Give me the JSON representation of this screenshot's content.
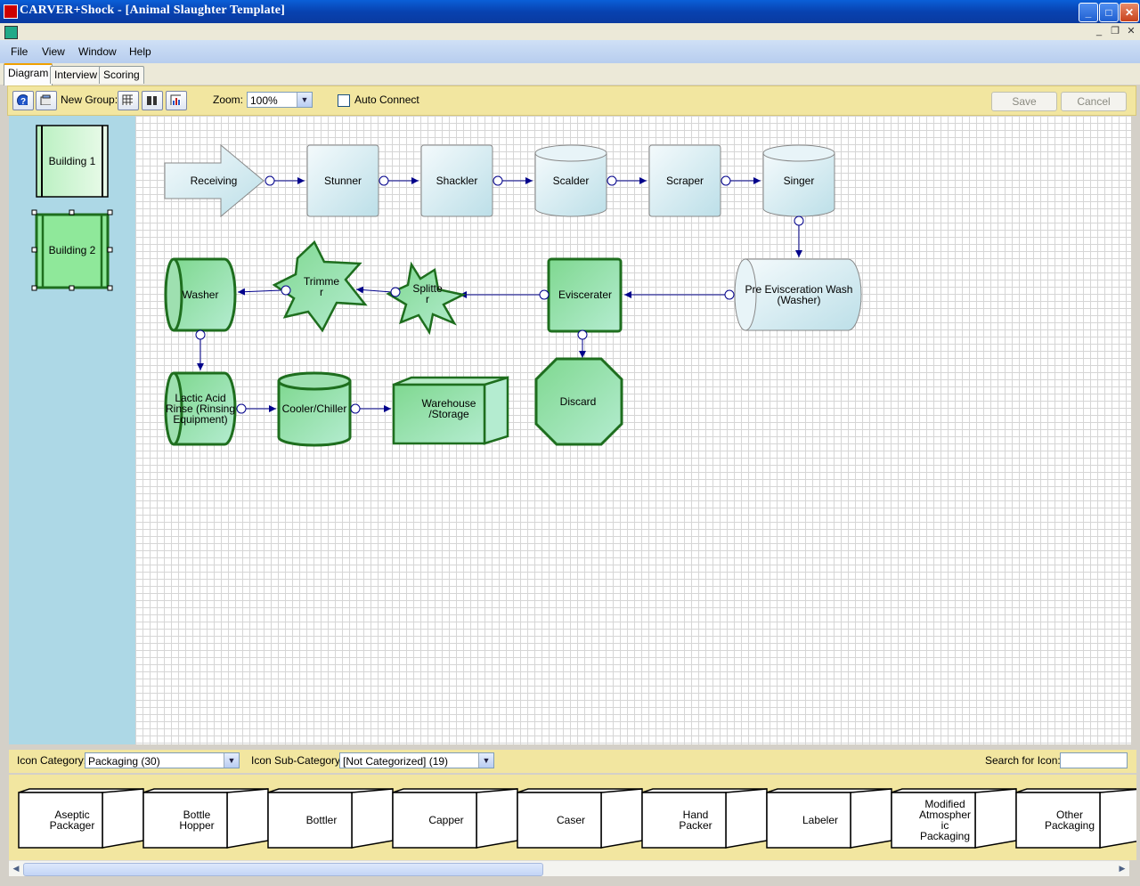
{
  "window": {
    "title": "CARVER+Shock - [Animal Slaughter Template]",
    "min_glyph": "_",
    "max_glyph": "□",
    "close_glyph": "✕",
    "mdi_min_glyph": "_",
    "mdi_restore_glyph": "❐",
    "mdi_close_glyph": "✕"
  },
  "menu": {
    "items": [
      "File",
      "View",
      "Window",
      "Help"
    ]
  },
  "tabs": [
    {
      "label": "Diagram",
      "active": true
    },
    {
      "label": "Interview",
      "active": false
    },
    {
      "label": "Scoring",
      "active": false
    }
  ],
  "toolbar": {
    "new_group_label": "New Group:",
    "zoom_label": "Zoom:",
    "zoom_value": "100%",
    "auto_connect_label": "Auto Connect",
    "auto_connect_checked": false,
    "save_label": "Save",
    "cancel_label": "Cancel"
  },
  "groups": [
    {
      "label": "Building 1",
      "selected": false
    },
    {
      "label": "Building 2",
      "selected": true
    }
  ],
  "diagram": {
    "nodes": {
      "receiving": [
        "Receiving"
      ],
      "stunner": [
        "Stunner"
      ],
      "shackler": [
        "Shackler"
      ],
      "scalder": [
        "Scalder"
      ],
      "scraper": [
        "Scraper"
      ],
      "singer": [
        "Singer"
      ],
      "pre_evisceration_wash": [
        "Pre Evisceration Wash",
        "(Washer)"
      ],
      "eviscerater": [
        "Eviscerater"
      ],
      "splitter": [
        "Splitte",
        "r"
      ],
      "trimmer": [
        "Trimme",
        "r"
      ],
      "washer": [
        "Washer"
      ],
      "lactic_acid_rinse": [
        "Lactic Acid",
        "Rinse (Rinsing",
        "Equipment)"
      ],
      "cooler_chiller": [
        "Cooler/Chiller"
      ],
      "warehouse_storage": [
        "Warehouse",
        "/Storage"
      ],
      "discard": [
        "Discard"
      ]
    }
  },
  "icon_bar": {
    "category_label": "Icon Category:",
    "category_value": "Packaging (30)",
    "subcategory_label": "Icon Sub-Category:",
    "subcategory_value": "[Not Categorized] (19)",
    "search_label": "Search for Icon:",
    "search_value": ""
  },
  "palette": [
    [
      "Aseptic",
      "Packager"
    ],
    [
      "Bottle",
      "Hopper"
    ],
    [
      "Bottler"
    ],
    [
      "Capper"
    ],
    [
      "Caser"
    ],
    [
      "Hand",
      "Packer"
    ],
    [
      "Labeler"
    ],
    [
      "Modified",
      "Atmospher",
      "ic",
      "Packaging"
    ],
    [
      "Other",
      "Packaging"
    ]
  ],
  "colors": {
    "blue_node_fill": "#dceef4",
    "green_node_fill": "#9ee0b0",
    "green_stroke": "#1e6e1e",
    "connector": "#00008b",
    "panel_yellow": "#f2e6a0",
    "left_pane": "#add8e6"
  },
  "icons": [
    "help-icon",
    "view-icon",
    "grid-group-icon",
    "column-group-icon",
    "chart-group-icon"
  ]
}
